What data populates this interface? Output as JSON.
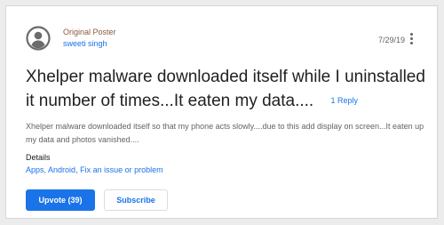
{
  "post": {
    "role": "Original Poster",
    "author": "sweeti singh",
    "date": "7/29/19",
    "title": "Xhelper malware downloaded itself while I uninstalled it number of times...It eaten my data....",
    "reply_count": "1 Reply",
    "body": "Xhelper malware downloaded itself so that my phone acts slowly....due to this add display on screen...It eaten up my data and photos vanished...."
  },
  "details": {
    "label": "Details",
    "tags": [
      "Apps",
      "Android",
      "Fix an issue or problem"
    ]
  },
  "actions": {
    "upvote_label": "Upvote (39)",
    "subscribe_label": "Subscribe"
  },
  "icons": {
    "avatar": "account-circle-icon",
    "more": "more-vert-icon"
  },
  "colors": {
    "accent": "#1a73e8",
    "role": "#8a5a3c",
    "avatar": "#6b6b6b"
  }
}
